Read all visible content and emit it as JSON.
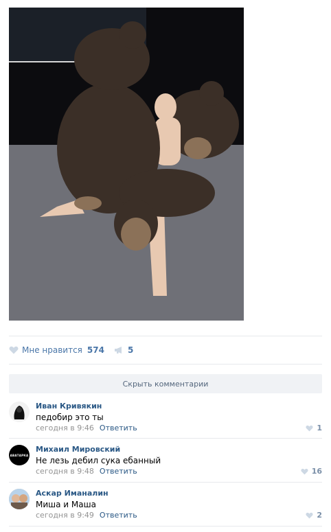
{
  "post": {
    "likes_label": "Мне нравится",
    "likes_count": "574",
    "shares_count": "5",
    "hide_comments_label": "Скрыть комментарии"
  },
  "comments": [
    {
      "author": "Иван Кривякин",
      "text": "педобир это ты",
      "time": "сегодня в 9:46",
      "reply_label": "Ответить",
      "likes": "1"
    },
    {
      "author": "Михаил Мировский",
      "avatar_text": "АВАТАРКА",
      "text": "Не лезь дебил сука ебанный",
      "time": "сегодня в 9:48",
      "reply_label": "Ответить",
      "likes": "16"
    },
    {
      "author": "Аскар Иманалин",
      "text": "Миша и Маша",
      "time": "сегодня в 9:49",
      "reply_label": "Ответить",
      "likes": "2"
    }
  ],
  "icons": {
    "like": "heart-icon",
    "share": "megaphone-icon"
  },
  "colors": {
    "link": "#2a5885",
    "accent": "#4a76a8",
    "muted": "#939393",
    "button_bg": "#f0f2f5"
  }
}
